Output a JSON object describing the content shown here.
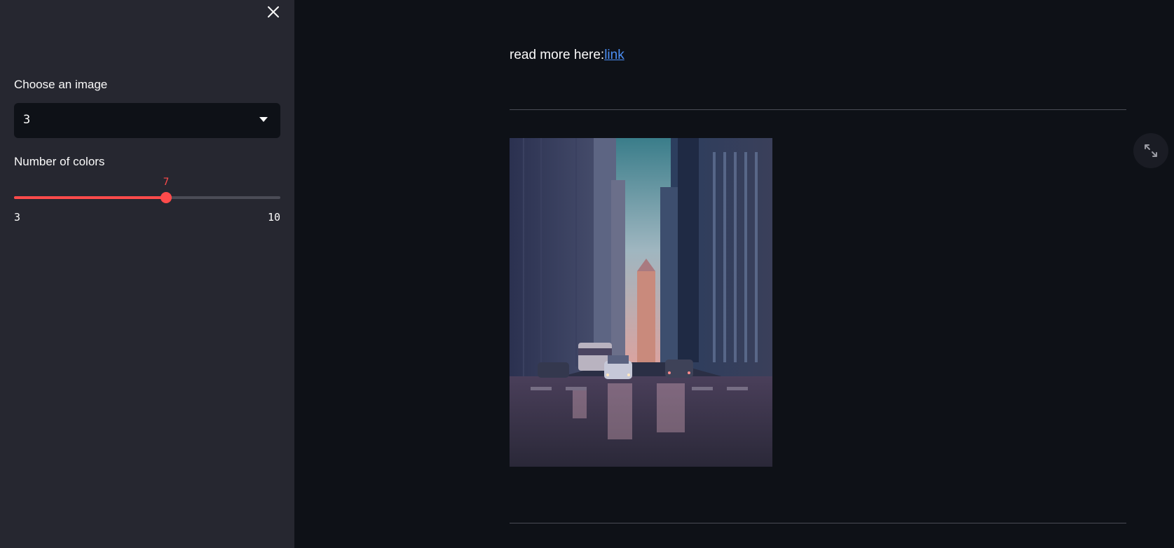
{
  "sidebar": {
    "image_select": {
      "label": "Choose an image",
      "value": "3"
    },
    "colors_slider": {
      "label": "Number of colors",
      "value": "7",
      "min": "3",
      "max": "10",
      "fraction": 0.5714
    },
    "close_icon": "close-icon"
  },
  "main": {
    "readmore_text": "read more here:",
    "link_text": "link",
    "expand_icon": "fullscreen-icon"
  },
  "colors": {
    "background": "#0e1117",
    "sidebar": "#262730",
    "accent": "#ff4b4b",
    "link": "#4c8ff5",
    "text": "#fafafa"
  }
}
